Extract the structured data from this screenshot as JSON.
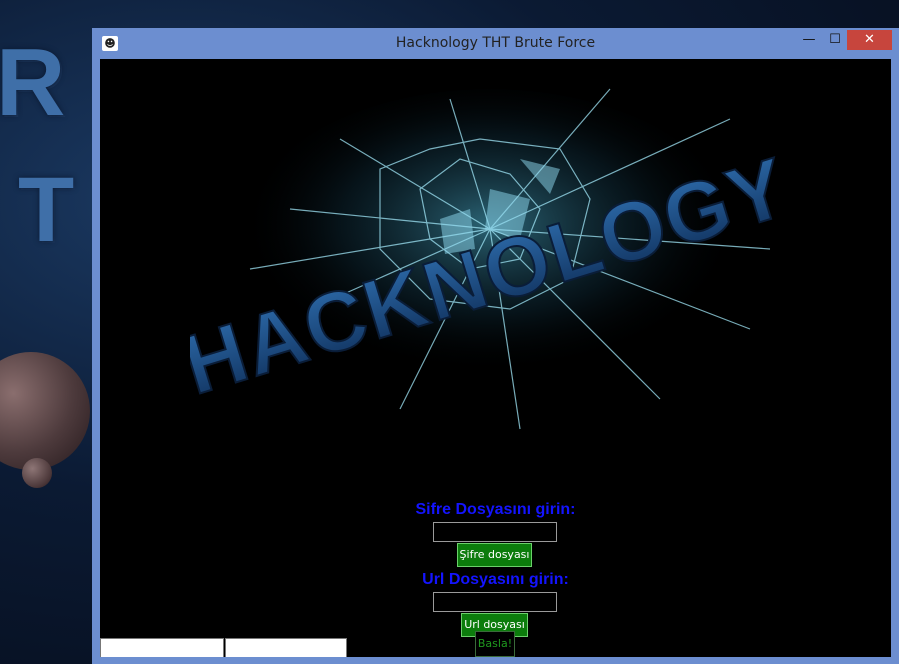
{
  "window": {
    "title": "Hacknology THT Brute Force",
    "minimize_glyph": "—",
    "maximize_glyph": "☐",
    "close_glyph": "✕"
  },
  "logo": {
    "text": "HACKNOLOGY"
  },
  "password_section": {
    "label": "Sifre Dosyasını girin:",
    "input_value": "",
    "button_label": "Şifre dosyası"
  },
  "url_section": {
    "label": "Url Dosyasını girin:",
    "input_value": "",
    "button_label": "Url dosyası"
  },
  "start_button": {
    "label": "Basla!"
  },
  "colors": {
    "label_blue": "#1414ff",
    "button_green": "#0c7c0c",
    "close_red": "#c7453d",
    "window_frame": "#6c8ed0"
  }
}
